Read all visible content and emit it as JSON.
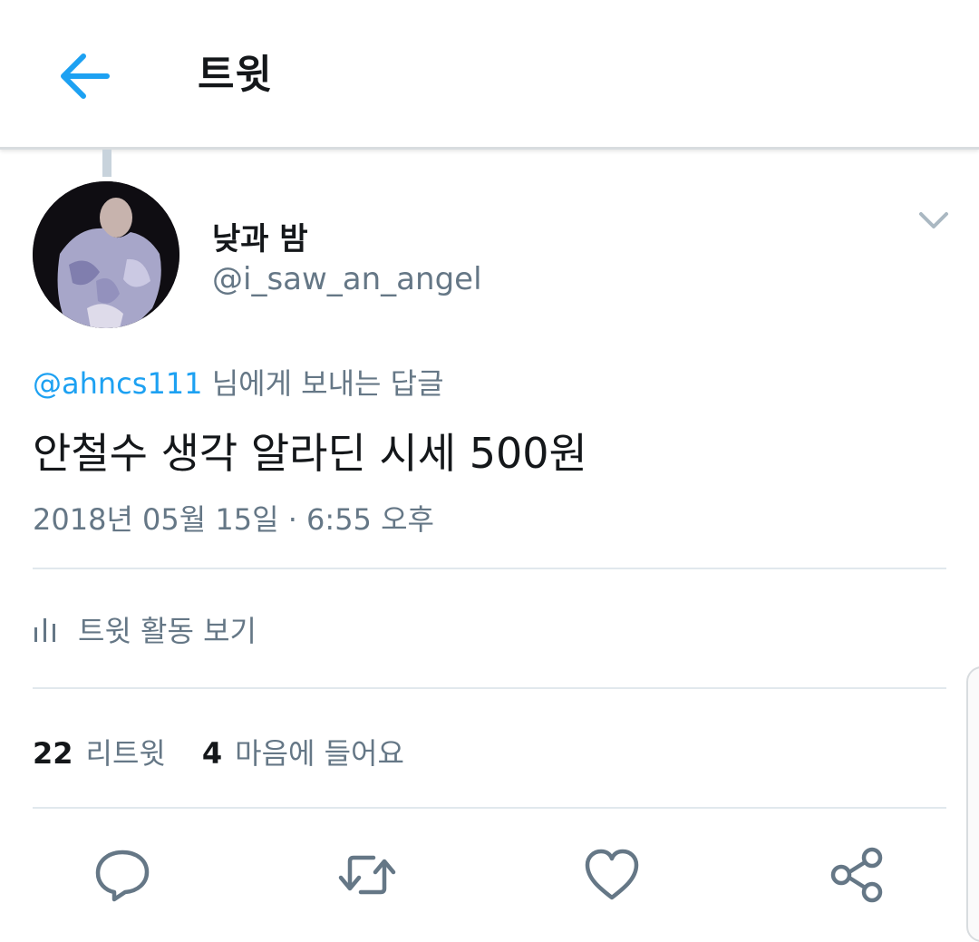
{
  "header": {
    "title": "트윗",
    "back_icon": "arrow-left-icon",
    "accent_color": "#1da1f2"
  },
  "author": {
    "display_name": "낮과 밤",
    "handle": "@i_saw_an_angel",
    "avatar_icon": "profile-photo",
    "more_icon": "chevron-down-icon"
  },
  "tweet": {
    "reply_to_handle": "@ahncs111",
    "reply_to_suffix": " 님에게 보내는 답글",
    "text": "안철수 생각 알라딘 시세 500원",
    "timestamp": "2018년 05월 15일 · 6:55 오후"
  },
  "activity": {
    "label": "트윗 활동 보기",
    "icon": "bar-chart-icon"
  },
  "stats": {
    "retweet_count": "22",
    "retweet_label": "리트윗",
    "like_count": "4",
    "like_label": "마음에 들어요"
  },
  "actions": [
    {
      "name": "reply",
      "icon": "reply-icon"
    },
    {
      "name": "retweet",
      "icon": "retweet-icon"
    },
    {
      "name": "like",
      "icon": "heart-icon"
    },
    {
      "name": "share",
      "icon": "share-icon"
    }
  ]
}
